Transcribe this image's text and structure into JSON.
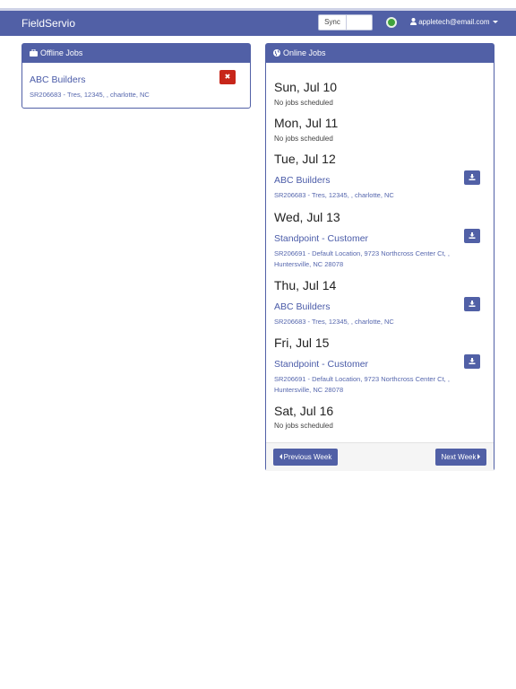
{
  "navbar": {
    "brand": "FieldServio",
    "sync_label": "Sync",
    "user_email": "appletech@email.com",
    "status_color": "#3fa33b"
  },
  "offline": {
    "title": "Offline Jobs",
    "jobs": [
      {
        "name": "ABC Builders",
        "detail": "SR206683 - Tres, 12345, , charlotte, NC",
        "remove_icon": "x-icon"
      }
    ]
  },
  "online": {
    "title": "Online Jobs",
    "days": [
      {
        "label": "Sun, Jul 10",
        "empty": "No jobs scheduled"
      },
      {
        "label": "Mon, Jul 11",
        "empty": "No jobs scheduled"
      },
      {
        "label": "Tue, Jul 12",
        "jobs": [
          {
            "name": "ABC Builders",
            "detail": "SR206683 - Tres, 12345, , charlotte, NC"
          }
        ]
      },
      {
        "label": "Wed, Jul 13",
        "jobs": [
          {
            "name": "Standpoint - Customer",
            "detail": "SR206691 - Default Location, 9723 Northcross Center Ct, , Huntersville, NC 28078"
          }
        ]
      },
      {
        "label": "Thu, Jul 14",
        "jobs": [
          {
            "name": "ABC Builders",
            "detail": "SR206683 - Tres, 12345, , charlotte, NC"
          }
        ]
      },
      {
        "label": "Fri, Jul 15",
        "jobs": [
          {
            "name": "Standpoint - Customer",
            "detail": "SR206691 - Default Location, 9723 Northcross Center Ct, , Huntersville, NC 28078"
          }
        ]
      },
      {
        "label": "Sat, Jul 16",
        "empty": "No jobs scheduled"
      }
    ],
    "prev_label": "Previous Week",
    "next_label": "Next Week"
  },
  "colors": {
    "primary": "#5160a6",
    "danger": "#c7261a"
  }
}
